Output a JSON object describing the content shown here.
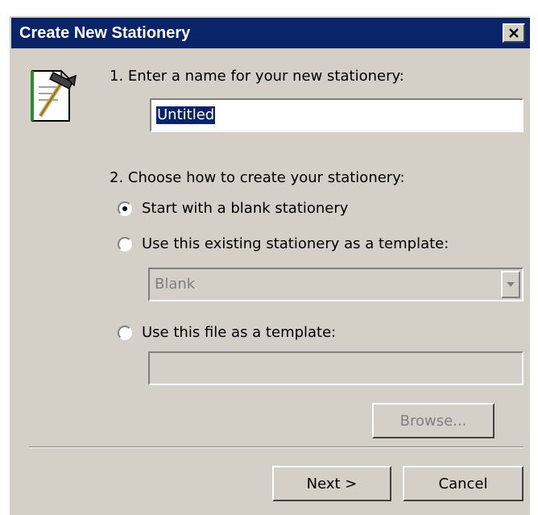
{
  "window": {
    "title": "Create New Stationery",
    "close_icon": "close-icon"
  },
  "step1": {
    "label": "1. Enter a name for your new stationery:",
    "name_value": "Untitled"
  },
  "step2": {
    "label": "2. Choose how to create your stationery:",
    "options": [
      {
        "label": "Start with a blank stationery",
        "selected": true
      },
      {
        "label": "Use this existing stationery as a template:",
        "selected": false
      },
      {
        "label": "Use this file as a template:",
        "selected": false
      }
    ],
    "template_select": {
      "value": "Blank",
      "enabled": false
    },
    "file_path": {
      "value": "",
      "enabled": false
    },
    "browse_label": "Browse..."
  },
  "footer": {
    "next_label": "Next >",
    "cancel_label": "Cancel"
  },
  "colors": {
    "titlebar": "#0a246a",
    "face": "#d4d0c8",
    "selection": "#0a246a",
    "disabled_text": "#808080"
  },
  "icons": {
    "wizard": "stationery-hammer-icon"
  }
}
